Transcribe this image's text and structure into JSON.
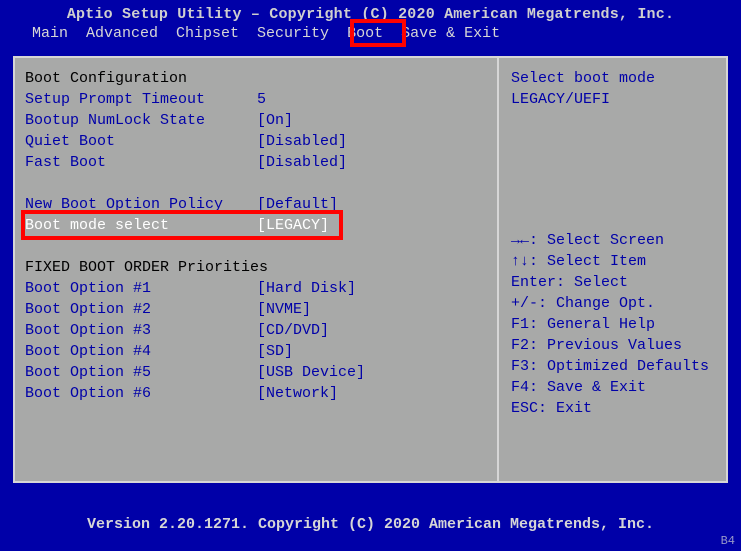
{
  "header": "Aptio Setup Utility – Copyright (C) 2020 American Megatrends, Inc.",
  "footer": "Version 2.20.1271. Copyright (C) 2020 American Megatrends, Inc.",
  "corner_badge": "B4",
  "menu": {
    "items": [
      "Main",
      "Advanced",
      "Chipset",
      "Security",
      "Boot",
      "Save & Exit"
    ],
    "active_index": 4
  },
  "left": {
    "section1_title": "Boot Configuration",
    "rows1": [
      {
        "label": "Setup Prompt Timeout",
        "value": "5"
      },
      {
        "label": "Bootup NumLock State",
        "value": "[On]"
      },
      {
        "label": "Quiet Boot",
        "value": "[Disabled]"
      },
      {
        "label": "Fast Boot",
        "value": "[Disabled]"
      }
    ],
    "rows2": [
      {
        "label": "New Boot Option Policy",
        "value": "[Default]"
      }
    ],
    "selected": {
      "label": "Boot mode select",
      "value": "[LEGACY]"
    },
    "section2_title": "FIXED BOOT ORDER Priorities",
    "rows3": [
      {
        "label": "Boot Option #1",
        "value": "[Hard Disk]"
      },
      {
        "label": "Boot Option #2",
        "value": "[NVME]"
      },
      {
        "label": "Boot Option #3",
        "value": "[CD/DVD]"
      },
      {
        "label": "Boot Option #4",
        "value": "[SD]"
      },
      {
        "label": "Boot Option #5",
        "value": "[USB Device]"
      },
      {
        "label": "Boot Option #6",
        "value": "[Network]"
      }
    ]
  },
  "right": {
    "help1": "Select boot mode",
    "help2": "LEGACY/UEFI",
    "nav": [
      "→←: Select Screen",
      "↑↓: Select Item",
      "Enter: Select",
      "+/-: Change Opt.",
      "F1: General Help",
      "F2: Previous Values",
      "F3: Optimized Defaults",
      "F4: Save & Exit",
      "ESC: Exit"
    ]
  }
}
